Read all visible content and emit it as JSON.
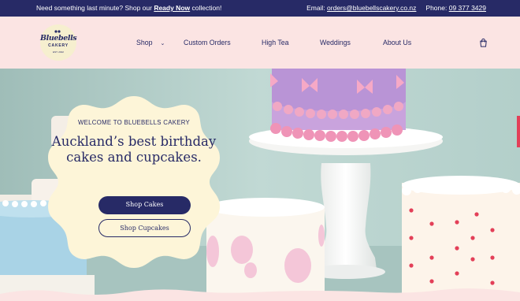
{
  "announcement": {
    "left_prefix": "Need something last minute? Shop our ",
    "left_link": "Ready Now",
    "left_suffix": " collection!",
    "email_label": "Email: ",
    "email": "orders@bluebellscakery.co.nz",
    "phone_label": "Phone: ",
    "phone": "09 377 3429"
  },
  "logo": {
    "name": "Bluebells",
    "subtitle": "CAKERY",
    "tagline": "EST. 2022"
  },
  "nav": {
    "items": [
      "Shop",
      "Custom Orders",
      "High Tea",
      "Weddings",
      "About Us"
    ],
    "shop_chevron": "⌄",
    "cart_icon": "cart-icon"
  },
  "hero": {
    "eyebrow": "WELCOME TO BLUEBELLS CAKERY",
    "headline": "Auckland’s best birthday cakes and cupcakes.",
    "primary_button": "Shop Cakes",
    "secondary_button": "Shop Cupcakes"
  },
  "colors": {
    "navy": "#272a66",
    "pink_background": "#fbe4e3",
    "cream": "#fdf5d8",
    "hero_wall": "#b8d2cd"
  }
}
